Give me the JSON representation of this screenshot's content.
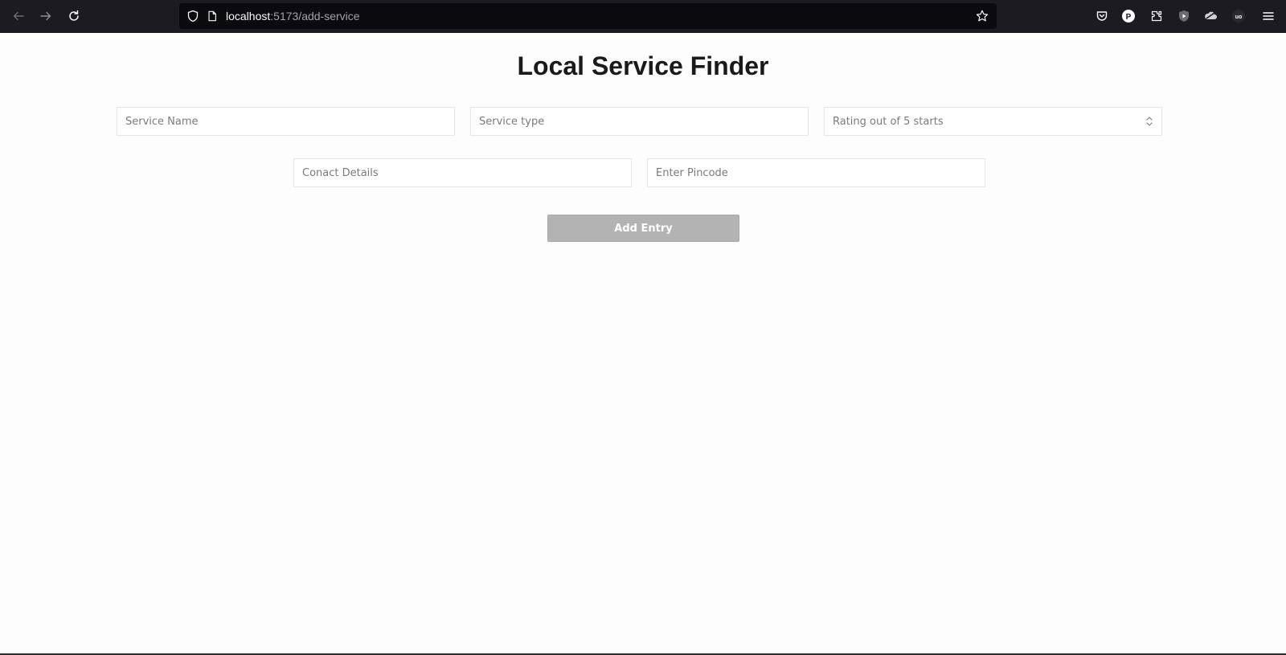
{
  "browser": {
    "url_host": "localhost",
    "url_rest": ":5173/add-service",
    "icons": {
      "back": "arrow-left-icon",
      "forward": "arrow-right-icon",
      "reload": "reload-icon",
      "shield": "shield-icon",
      "page": "page-icon",
      "bookmark": "star-icon",
      "pocket": "pocket-icon",
      "profile": "profile-icon",
      "extensions": "puzzle-icon",
      "menu": "hamburger-menu-icon"
    },
    "profile_letter": "P",
    "ext_ublock_label": "uo"
  },
  "page": {
    "title": "Local Service Finder",
    "fields": {
      "service_name": {
        "placeholder": "Service Name"
      },
      "service_type": {
        "placeholder": "Service type"
      },
      "rating": {
        "placeholder": "Rating out of 5 starts"
      },
      "contact": {
        "placeholder": "Conact Details"
      },
      "pincode": {
        "placeholder": "Enter Pincode"
      }
    },
    "add_button_label": "Add Entry"
  },
  "colors": {
    "toolbar_bg": "#1c1b22",
    "urlbar_bg": "#0b0a0e",
    "page_bg": "#fdfdfd",
    "button_bg": "#b3b3b3"
  }
}
